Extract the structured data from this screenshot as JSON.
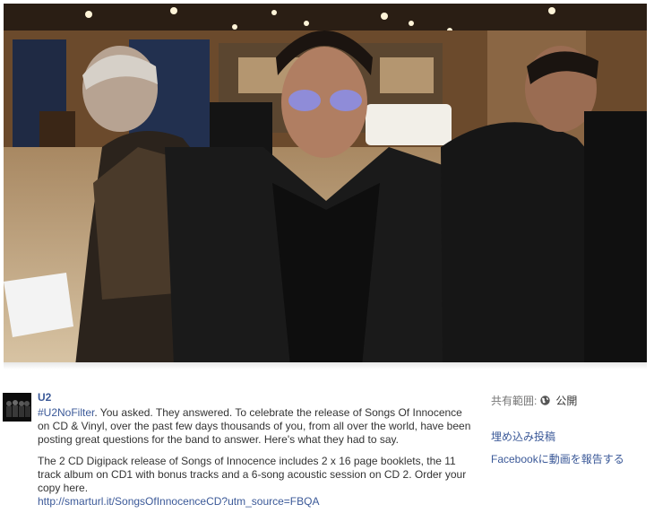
{
  "post": {
    "page_name": "U2",
    "hashtag": "#U2NoFilter",
    "paragraph1": ". You asked. They answered. To celebrate the release of Songs Of Innocence on CD & Vinyl, over the past few days thousands of you, from all over the world, have been posting great questions for the band to answer. Here's what they had to say.",
    "paragraph2": "The 2 CD Digipack release of Songs of Innocence includes 2 x 16 page booklets, the 11 track album on CD1 with bonus tracks and a 6-song acoustic session on CD 2. Order your copy here.",
    "url": "http://smarturl.it/SongsOfInnocenceCD?utm_source=FBQA"
  },
  "sidebar": {
    "privacy_label": "共有範囲:",
    "privacy_value": "公開",
    "embed_post": "埋め込み投稿",
    "report_video": "Facebookに動画を報告する"
  },
  "icons": {
    "privacy": "globe-icon"
  }
}
